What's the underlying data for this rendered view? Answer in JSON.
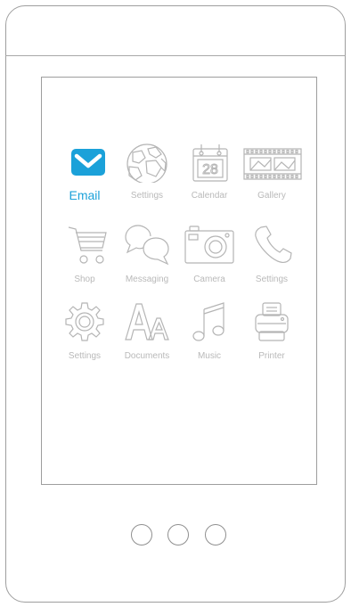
{
  "colors": {
    "accent": "#1ba1d9",
    "icon": "#b5b5b5",
    "frame": "#9e9e9e"
  },
  "home_screen": {
    "apps": [
      {
        "label": "Email",
        "icon": "envelope-icon",
        "active": true
      },
      {
        "label": "Settings",
        "icon": "globe-icon"
      },
      {
        "label": "Calendar",
        "icon": "calendar-icon",
        "calendar_day": "28"
      },
      {
        "label": "Gallery",
        "icon": "film-strip-icon"
      },
      {
        "label": "Shop",
        "icon": "shopping-cart-icon"
      },
      {
        "label": "Messaging",
        "icon": "chat-bubbles-icon"
      },
      {
        "label": "Camera",
        "icon": "camera-icon"
      },
      {
        "label": "Settings",
        "icon": "phone-handset-icon"
      },
      {
        "label": "Settings",
        "icon": "gear-icon"
      },
      {
        "label": "Documents",
        "icon": "font-aa-icon"
      },
      {
        "label": "Music",
        "icon": "music-note-icon"
      },
      {
        "label": "Printer",
        "icon": "printer-icon"
      }
    ]
  },
  "nav_buttons": [
    "nav-button-1",
    "nav-button-2",
    "nav-button-3"
  ]
}
